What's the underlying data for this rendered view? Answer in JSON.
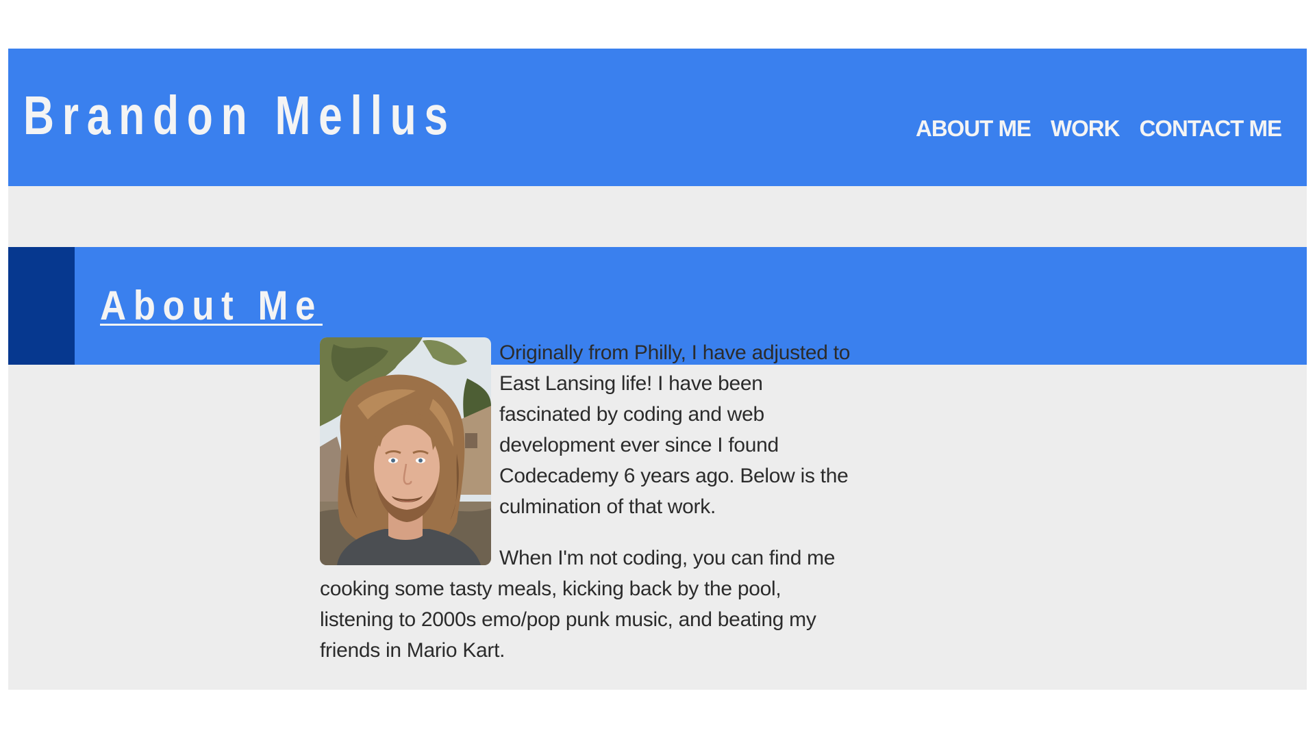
{
  "header": {
    "title": "Brandon Mellus",
    "nav": [
      {
        "label": "ABOUT ME"
      },
      {
        "label": "WORK"
      },
      {
        "label": "CONTACT ME"
      }
    ]
  },
  "about": {
    "heading": "About Me",
    "paragraphs": [
      "Originally from Philly, I have adjusted to East Lansing life! I have been fascinated by coding and web development ever since I found Codecademy 6 years ago. Below is the culmination of that work.",
      "When I'm not coding, you can find me cooking some tasty meals, kicking back by the pool, listening to 2000s emo/pop punk music, and beating my friends in Mario Kart."
    ]
  },
  "colors": {
    "primary": "#3a80ee",
    "accent_dark": "#06388f",
    "background": "#ededed",
    "text": "#2b2b2b",
    "header_text": "#f4f4f4"
  }
}
